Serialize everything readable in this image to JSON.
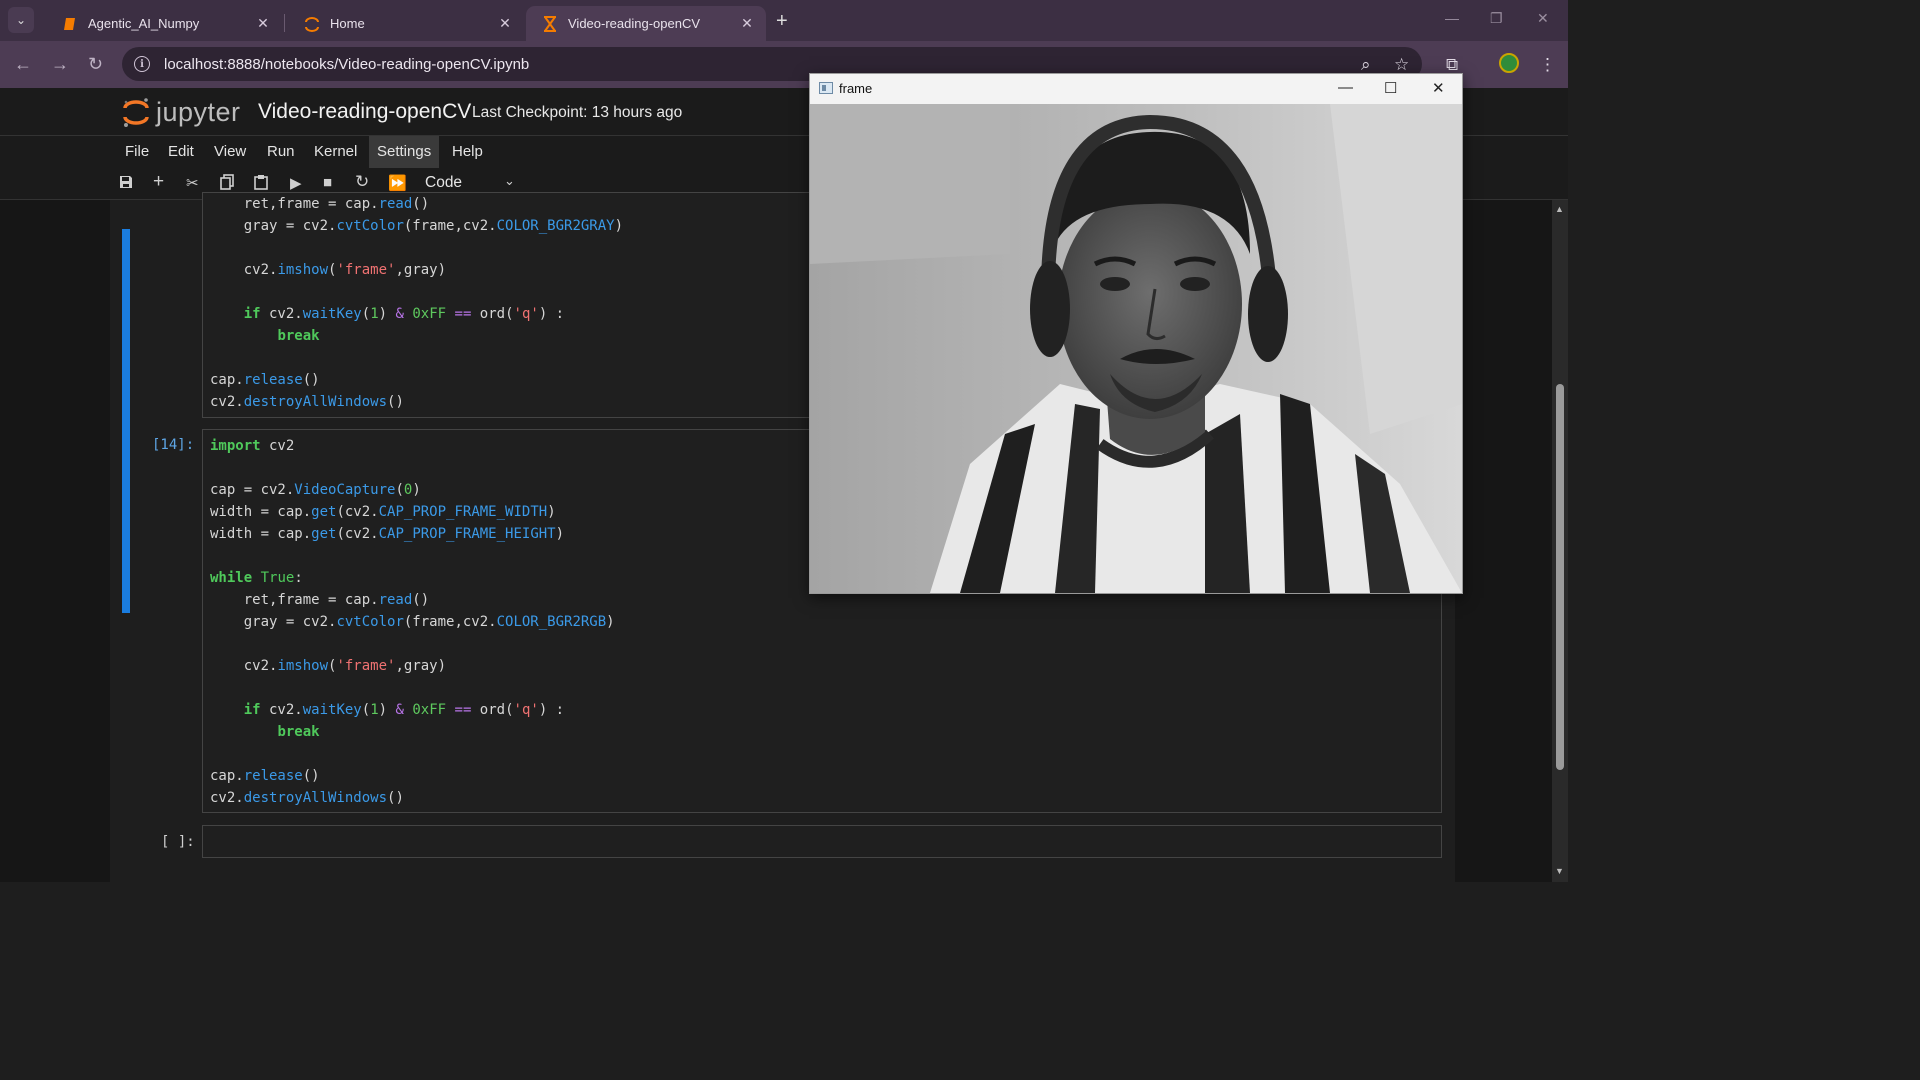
{
  "browser": {
    "tabs": [
      {
        "label": "Agentic_AI_Numpy",
        "icon": "notebook-icon",
        "active": false
      },
      {
        "label": "Home",
        "icon": "jupyter-icon",
        "active": false
      },
      {
        "label": "Video-reading-openCV",
        "icon": "hourglass-icon",
        "active": true
      }
    ],
    "close_glyph": "✕",
    "new_tab_glyph": "+",
    "url": "localhost:8888/notebooks/Video-reading-openCV.ipynb"
  },
  "jupyter": {
    "logo_text": "jupyter",
    "notebook_title": "Video-reading-openCV",
    "checkpoint": "Last Checkpoint: 13 hours ago",
    "menu": [
      "File",
      "Edit",
      "View",
      "Run",
      "Kernel",
      "Settings",
      "Help"
    ],
    "active_menu": "Settings",
    "cell_type": "Code"
  },
  "cells": {
    "prev_prompt": "",
    "current_prompt": "[14]:",
    "empty_prompt": "[ ]:"
  },
  "cv_window": {
    "title": "frame"
  },
  "colors": {
    "accent": "#1a7de0",
    "keyword": "#4fc95b",
    "function": "#3b9ae8",
    "string": "#f07272",
    "operator": "#b874e8"
  }
}
